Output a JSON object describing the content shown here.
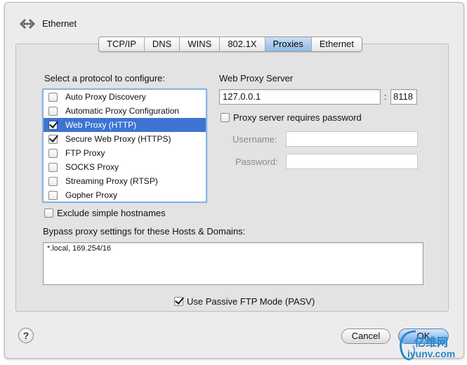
{
  "window": {
    "title": "Ethernet"
  },
  "tabs": [
    {
      "label": "TCP/IP",
      "selected": false
    },
    {
      "label": "DNS",
      "selected": false
    },
    {
      "label": "WINS",
      "selected": false
    },
    {
      "label": "802.1X",
      "selected": false
    },
    {
      "label": "Proxies",
      "selected": true
    },
    {
      "label": "Ethernet",
      "selected": false
    }
  ],
  "protocols": {
    "heading": "Select a protocol to configure:",
    "items": [
      {
        "label": "Auto Proxy Discovery",
        "checked": false,
        "selected": false
      },
      {
        "label": "Automatic Proxy Configuration",
        "checked": false,
        "selected": false
      },
      {
        "label": "Web Proxy (HTTP)",
        "checked": true,
        "selected": true
      },
      {
        "label": "Secure Web Proxy (HTTPS)",
        "checked": true,
        "selected": false
      },
      {
        "label": "FTP Proxy",
        "checked": false,
        "selected": false
      },
      {
        "label": "SOCKS Proxy",
        "checked": false,
        "selected": false
      },
      {
        "label": "Streaming Proxy (RTSP)",
        "checked": false,
        "selected": false
      },
      {
        "label": "Gopher Proxy",
        "checked": false,
        "selected": false
      }
    ]
  },
  "server": {
    "heading": "Web Proxy Server",
    "host": "127.0.0.1",
    "separator": ":",
    "port": "8118",
    "requires_password_label": "Proxy server requires password",
    "requires_password": false,
    "username_label": "Username:",
    "username": "",
    "password_label": "Password:",
    "password": ""
  },
  "exclude_simple": {
    "label": "Exclude simple hostnames",
    "checked": false
  },
  "bypass": {
    "label": "Bypass proxy settings for these Hosts & Domains:",
    "value": "*.local, 169.254/16"
  },
  "passive_ftp": {
    "label": "Use Passive FTP Mode (PASV)",
    "checked": true
  },
  "footer": {
    "help": "?",
    "cancel": "Cancel",
    "ok": "OK"
  },
  "watermark": {
    "line1": "亿维网",
    "line2": "iyunv.com"
  },
  "colors": {
    "selection": "#3e74d2",
    "tab_selected": "#8fb9e3",
    "default_button": "#6ba6e8"
  }
}
